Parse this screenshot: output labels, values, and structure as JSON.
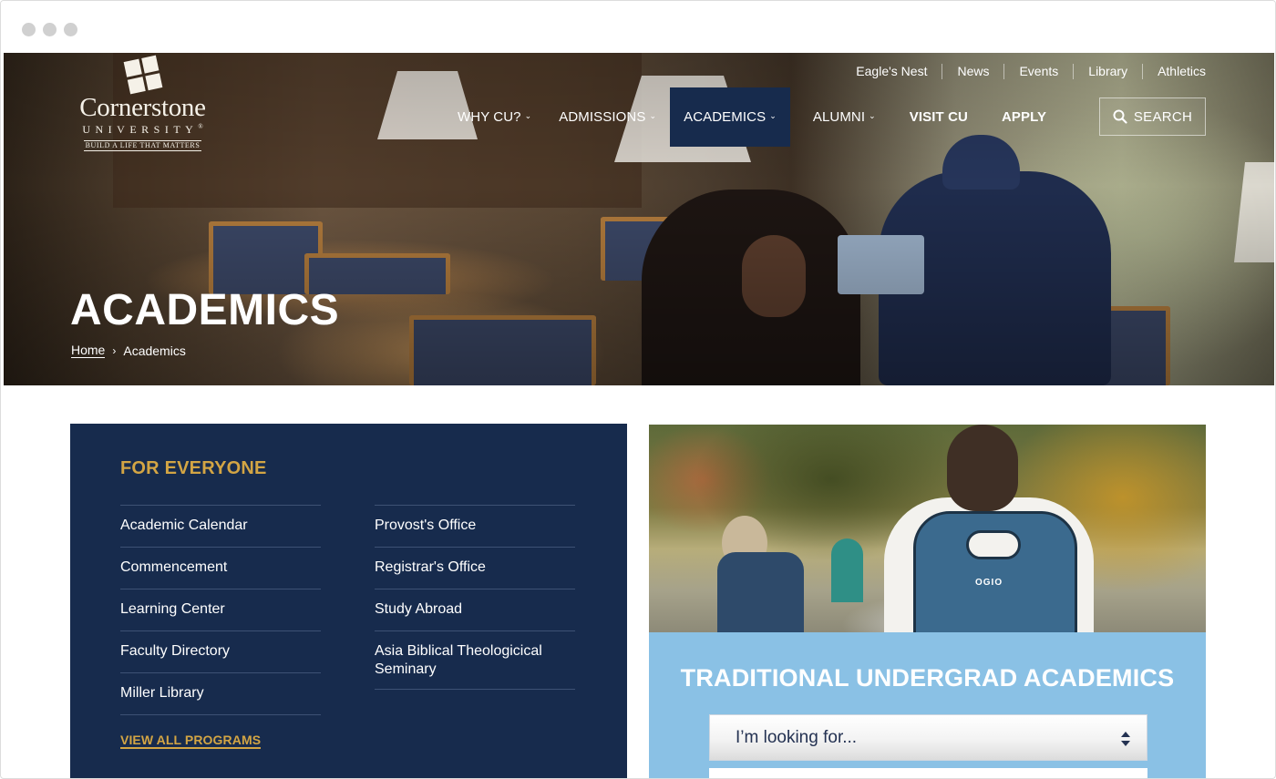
{
  "window": {
    "controls": [
      "close",
      "minimize",
      "maximize"
    ]
  },
  "logo": {
    "name": "Cornerstone",
    "sub": "UNIVERSITY",
    "registered": "®",
    "tagline": "BUILD A LIFE THAT MATTERS"
  },
  "utility_nav": [
    {
      "label": "Eagle's Nest"
    },
    {
      "label": "News"
    },
    {
      "label": "Events"
    },
    {
      "label": "Library"
    },
    {
      "label": "Athletics"
    }
  ],
  "main_nav": [
    {
      "label": "WHY CU?",
      "dropdown": true,
      "active": false
    },
    {
      "label": "ADMISSIONS",
      "dropdown": true,
      "active": false
    },
    {
      "label": "ACADEMICS",
      "dropdown": true,
      "active": true
    },
    {
      "label": "ALUMNI",
      "dropdown": true,
      "active": false
    },
    {
      "label": "VISIT CU",
      "dropdown": false,
      "active": false
    },
    {
      "label": "APPLY",
      "dropdown": false,
      "active": false
    }
  ],
  "chevron_glyph": "ˇ",
  "search": {
    "label": "SEARCH",
    "icon": "search-icon"
  },
  "hero": {
    "title": "ACADEMICS",
    "breadcrumb": {
      "home": "Home",
      "separator": "›",
      "current": "Academics"
    }
  },
  "for_everyone": {
    "heading": "FOR EVERYONE",
    "column_1": [
      {
        "label": "Academic Calendar"
      },
      {
        "label": "Commencement"
      },
      {
        "label": "Learning Center"
      },
      {
        "label": "Faculty Directory"
      },
      {
        "label": "Miller Library"
      }
    ],
    "column_2": [
      {
        "label": "Provost's Office"
      },
      {
        "label": "Registrar's Office"
      },
      {
        "label": "Study Abroad"
      },
      {
        "label": "Asia Biblical Theologicical Seminary"
      }
    ],
    "view_all": "VIEW ALL PROGRAMS"
  },
  "undergrad_card": {
    "title": "TRADITIONAL UNDERGRAD ACADEMICS",
    "photo_text": "OGIO",
    "select": {
      "placeholder": "I’m looking for...",
      "icon": "select-arrows-icon"
    }
  },
  "colors": {
    "navy": "#172b4d",
    "gold": "#d3a544",
    "light_blue": "#85bee4",
    "divider": "#3d5174"
  }
}
